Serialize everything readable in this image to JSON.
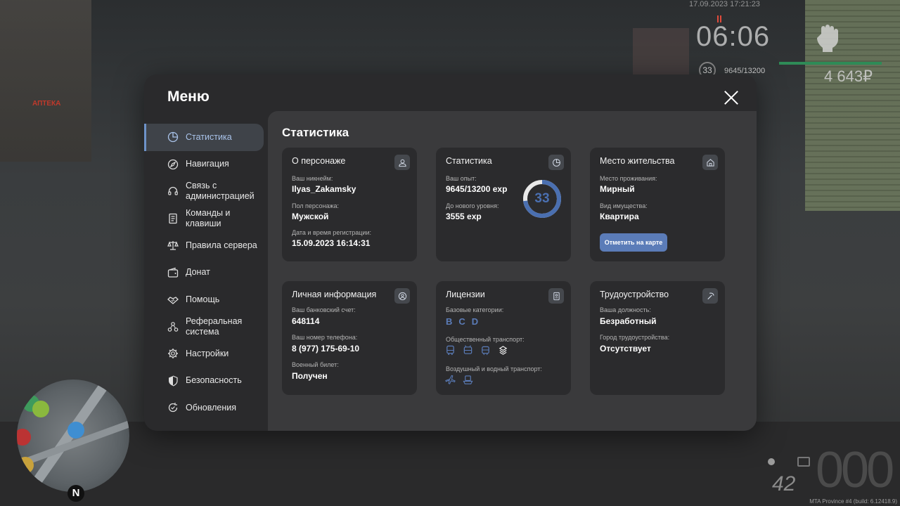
{
  "hud": {
    "date": "17.09.2023 17:21:23",
    "time": "06:06",
    "level": "33",
    "exp": "9645/13200",
    "money": "4 643₽",
    "fuel": "42",
    "build": "MTA Province #4 (build: 6.12418.9)"
  },
  "background": {
    "apteka": "АПТЕКА"
  },
  "menu": {
    "title": "Меню",
    "nav": [
      {
        "label": "Статистика",
        "icon": "pie-chart-icon"
      },
      {
        "label": "Навигация",
        "icon": "compass-icon"
      },
      {
        "label": "Связь с администрацией",
        "icon": "headset-icon"
      },
      {
        "label": "Команды и клавиши",
        "icon": "document-icon"
      },
      {
        "label": "Правила сервера",
        "icon": "scales-icon"
      },
      {
        "label": "Донат",
        "icon": "wallet-icon"
      },
      {
        "label": "Помощь",
        "icon": "handshake-icon"
      },
      {
        "label": "Реферальная система",
        "icon": "network-icon"
      },
      {
        "label": "Настройки",
        "icon": "gear-icon"
      },
      {
        "label": "Безопасность",
        "icon": "shield-icon"
      },
      {
        "label": "Обновления",
        "icon": "refresh-icon"
      }
    ]
  },
  "content": {
    "title": "Статистика",
    "character": {
      "title": "О персонаже",
      "nickname_label": "Ваш никнейм:",
      "nickname": "Ilyas_Zakamsky",
      "gender_label": "Пол персонажа:",
      "gender": "Мужской",
      "reg_label": "Дата и время регистрации:",
      "reg": "15.09.2023 16:14:31"
    },
    "stats": {
      "title": "Статистика",
      "exp_label": "Ваш опыт:",
      "exp": "9645/13200 exp",
      "next_label": "До нового уровня:",
      "next": "3555 exp",
      "level": "33",
      "progress": 0.73,
      "ring_color": "#4a6fb0"
    },
    "residence": {
      "title": "Место жительства",
      "place_label": "Место проживания:",
      "place": "Мирный",
      "property_label": "Вид имущества:",
      "property": "Квартира",
      "map_button": "Отметить на карте"
    },
    "personal": {
      "title": "Личная информация",
      "bank_label": "Ваш банковский счет:",
      "bank": "648114",
      "phone_label": "Ваш номер телефона:",
      "phone": "8 (977) 175-69-10",
      "military_label": "Военный билет:",
      "military": "Получен"
    },
    "licenses": {
      "title": "Лицензии",
      "base_label": "Базовые категории:",
      "base": [
        "B",
        "C",
        "D"
      ],
      "public_label": "Общественный транспорт:",
      "air_label": "Воздушный и водный транспорт:"
    },
    "employment": {
      "title": "Трудоустройство",
      "position_label": "Ваша должность:",
      "position": "Безработный",
      "city_label": "Город трудоустройства:",
      "city": "Отсутствует"
    }
  },
  "colors": {
    "accent": "#5b7cb8",
    "modal_bg": "#2a2a2c",
    "content_bg": "#3a3a3c",
    "card_bg": "#2b2b2d"
  }
}
